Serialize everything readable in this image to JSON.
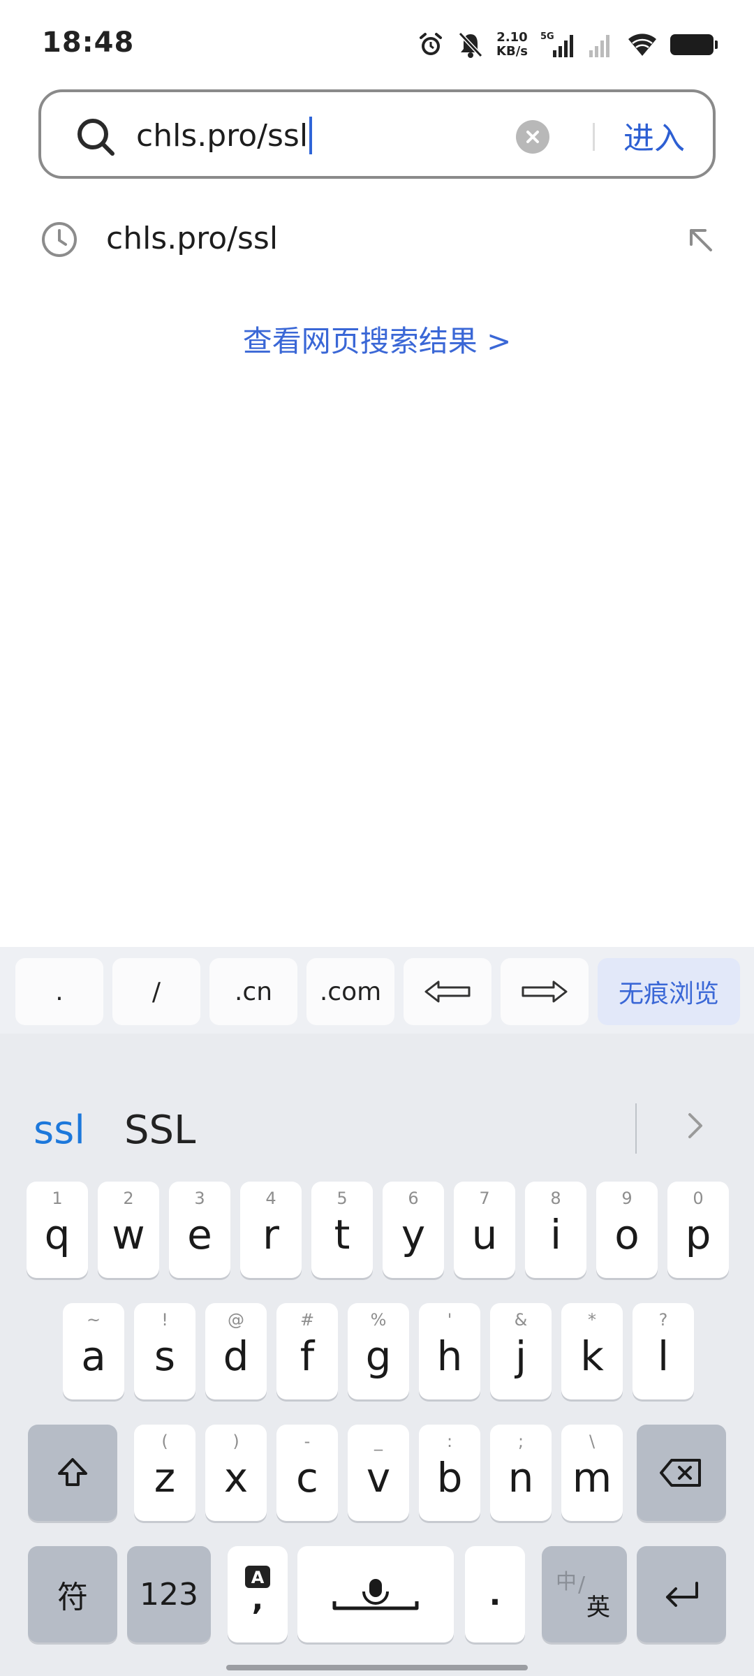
{
  "status_bar": {
    "time": "18:48",
    "net_speed_value": "2.10",
    "net_speed_unit": "KB/s",
    "network_type": "5G",
    "icons": [
      "alarm-icon",
      "mute-notification-icon",
      "signal-icon",
      "signal-weak-icon",
      "wifi-icon",
      "battery-icon"
    ]
  },
  "search": {
    "query": "chls.pro/ssl",
    "enter_label": "进入"
  },
  "suggestions": [
    {
      "text": "chls.pro/ssl",
      "icon": "history-clock-icon"
    }
  ],
  "web_results_link": "查看网页搜索结果 >",
  "quick_keys": [
    ".",
    "/",
    ".cn",
    ".com",
    "⇦",
    "⇨",
    "无痕浏览"
  ],
  "keyboard": {
    "candidates": [
      "ssl",
      "SSL"
    ],
    "row1": [
      {
        "k": "q",
        "h": "1"
      },
      {
        "k": "w",
        "h": "2"
      },
      {
        "k": "e",
        "h": "3"
      },
      {
        "k": "r",
        "h": "4"
      },
      {
        "k": "t",
        "h": "5"
      },
      {
        "k": "y",
        "h": "6"
      },
      {
        "k": "u",
        "h": "7"
      },
      {
        "k": "i",
        "h": "8"
      },
      {
        "k": "o",
        "h": "9"
      },
      {
        "k": "p",
        "h": "0"
      }
    ],
    "row2": [
      {
        "k": "a",
        "h": "~"
      },
      {
        "k": "s",
        "h": "!"
      },
      {
        "k": "d",
        "h": "@"
      },
      {
        "k": "f",
        "h": "#"
      },
      {
        "k": "g",
        "h": "%"
      },
      {
        "k": "h",
        "h": "'"
      },
      {
        "k": "j",
        "h": "&"
      },
      {
        "k": "k",
        "h": "*"
      },
      {
        "k": "l",
        "h": "?"
      }
    ],
    "row3": [
      {
        "k": "z",
        "h": "("
      },
      {
        "k": "x",
        "h": ")"
      },
      {
        "k": "c",
        "h": "-"
      },
      {
        "k": "v",
        "h": "_"
      },
      {
        "k": "b",
        "h": ":"
      },
      {
        "k": "n",
        "h": ";"
      },
      {
        "k": "m",
        "h": "\\"
      }
    ],
    "symbols_label": "符",
    "numbers_label": "123",
    "comma_label": ",",
    "period_label": ".",
    "lang_label_cn": "中",
    "lang_label_en": "英"
  },
  "colors": {
    "accent_blue": "#2d5fd3",
    "candidate_blue": "#1d78db",
    "keyboard_bg": "#e9ebef",
    "function_key": "#b6bcc6"
  }
}
